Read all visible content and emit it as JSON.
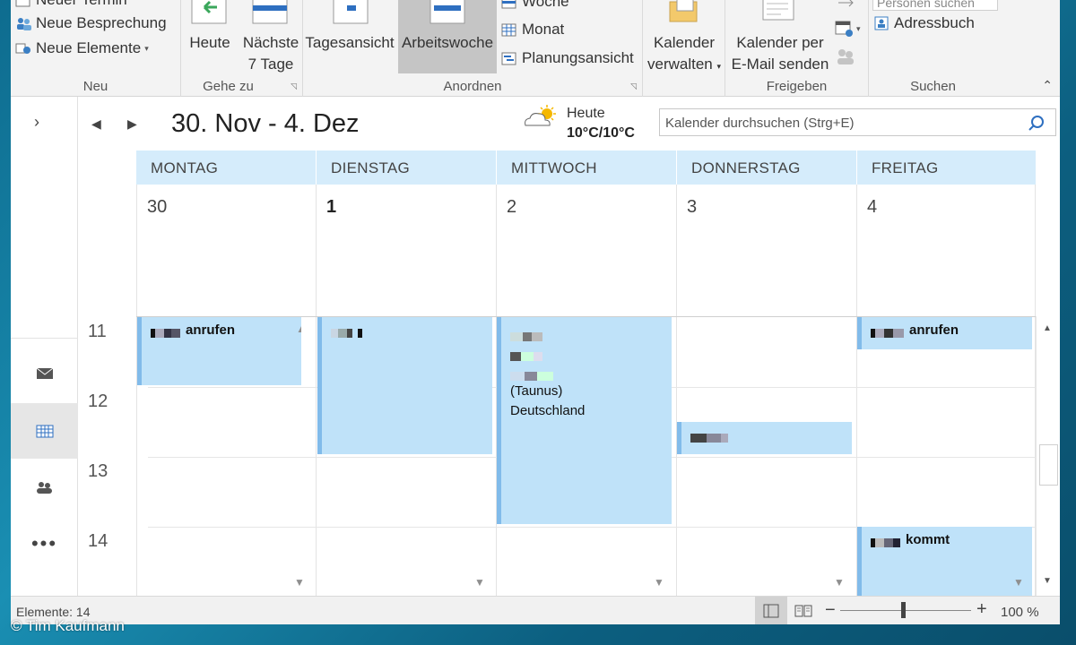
{
  "ribbon": {
    "neu": {
      "label": "Neu",
      "items": [
        "Neuer Termin",
        "Neue Besprechung",
        "Neue Elemente"
      ]
    },
    "gehe_zu": {
      "label": "Gehe zu",
      "heute": "Heute",
      "naechste_line1": "Nächste",
      "naechste_line2": "7 Tage"
    },
    "anordnen": {
      "label": "Anordnen",
      "tagesansicht": "Tagesansicht",
      "arbeitswoche": "Arbeitswoche",
      "woche": "Woche",
      "monat": "Monat",
      "planungsansicht": "Planungsansicht"
    },
    "verwalten": {
      "line1": "Kalender",
      "line2": "verwalten"
    },
    "freigeben": {
      "label": "Freigeben",
      "line1": "Kalender per",
      "line2": "E-Mail senden"
    },
    "suchen": {
      "label": "Suchen",
      "personen": "Personen suchen",
      "adressbuch": "Adressbuch"
    }
  },
  "header": {
    "date_range": "30. Nov - 4. Dez",
    "weather_label": "Heute",
    "weather_temp": "10°C/10°C",
    "search_placeholder": "Kalender durchsuchen (Strg+E)"
  },
  "days": [
    {
      "name": "MONTAG",
      "num": "30"
    },
    {
      "name": "DIENSTAG",
      "num": "1"
    },
    {
      "name": "MITTWOCH",
      "num": "2"
    },
    {
      "name": "DONNERSTAG",
      "num": "3"
    },
    {
      "name": "FREITAG",
      "num": "4"
    }
  ],
  "hours": [
    "11",
    "12",
    "13",
    "14"
  ],
  "appointments": {
    "mon": "anrufen",
    "wed_line1": "(Taunus)",
    "wed_line2": "Deutschland",
    "fri1": "anrufen",
    "fri2": "kommt"
  },
  "status": {
    "count": "Elemente: 14",
    "zoom": "100 %"
  },
  "copyright": "© Tim Kaufmann"
}
